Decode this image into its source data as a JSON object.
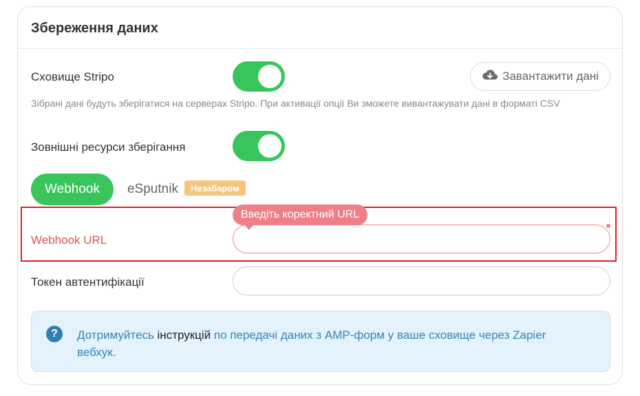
{
  "card": {
    "title": "Збереження даних"
  },
  "stripo_storage": {
    "label": "Сховище Stripo",
    "enabled": true,
    "download_button": "Завантажити дані",
    "download_icon": "cloud-download-icon",
    "hint": "Зібрані дані будуть зберігатися на серверах Stripo. При активації опції Ви зможете вивантажувати дані в форматі CSV"
  },
  "external_storage": {
    "label": "Зовнішні ресурси зберігання",
    "enabled": true
  },
  "tabs": {
    "webhook": "Webhook",
    "esputnik": "eSputnik",
    "soon_badge": "Незабаром"
  },
  "webhook_url": {
    "label": "Webhook URL",
    "value": "",
    "error_tooltip": "Введіть коректний URL"
  },
  "auth_token": {
    "label": "Токен автентифікації",
    "value": ""
  },
  "info": {
    "icon": "question-icon",
    "text_before": "Дотримуйтесь ",
    "link_text": "інструкцій",
    "text_after": " по передачі даних з AMP-форм у ваше сховище через Zapier вебхук."
  },
  "colors": {
    "accent_green": "#3ac55c",
    "error_red": "#e01e1e",
    "info_blue": "#3a83b3",
    "badge_orange": "#f3c57d"
  }
}
